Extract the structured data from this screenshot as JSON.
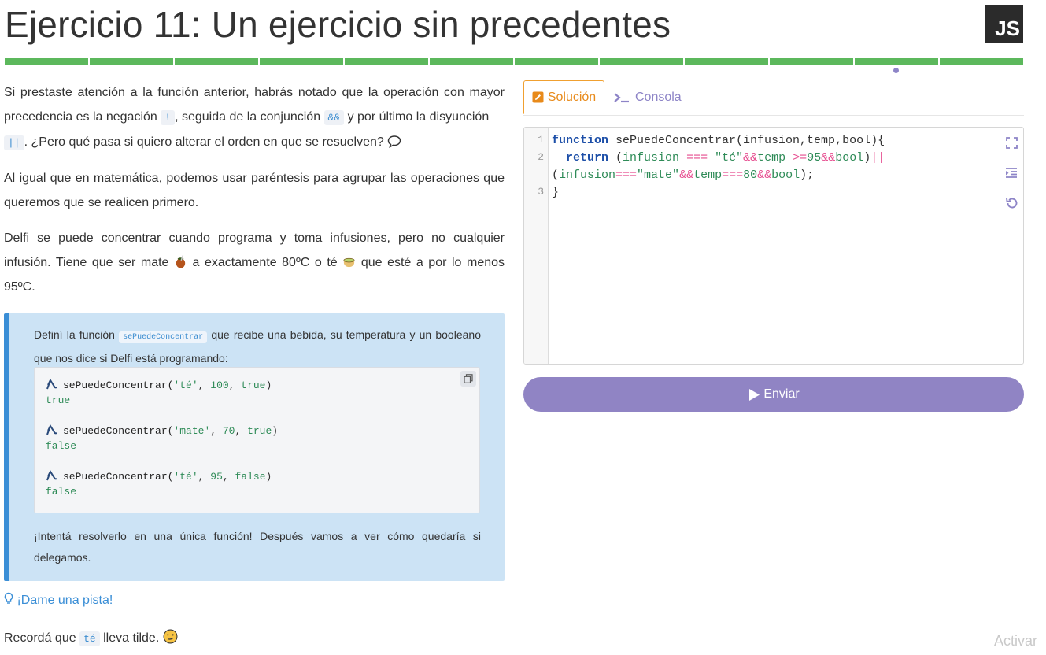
{
  "header": {
    "title": "Ejercicio 11: Un ejercicio sin precedentes",
    "language_badge": "JS",
    "progress_segments": 12,
    "progress_color": "#5cb85c"
  },
  "intro": {
    "p1_a": "Si prestaste atención a la función anterior, habrás notado que la operación con mayor precedencia es la negación ",
    "code_not": "!",
    "p1_b": ", seguida de la conjunción ",
    "code_and": "&&",
    "p1_c": " y por último la disyunción ",
    "code_or": "||",
    "p1_d": ". ¿Pero qué pasa si quiero alterar el orden en que se resuelven?",
    "p2": "Al igual que en matemática, podemos usar paréntesis para agrupar las operaciones que queremos que se realicen primero.",
    "p3_a": "Delfi se puede concentrar cuando programa y toma infusiones, pero no cualquier infusión. Tiene que ser mate ",
    "p3_b": " a exactamente 80ºC o té ",
    "p3_c": " que esté a por lo menos 95ºC."
  },
  "task": {
    "text_a": "Definí la función ",
    "fn_name": "sePuedeConcentrar",
    "text_b": " que recibe una bebida, su temperatura y un booleano que nos dice si Delfi está programando:",
    "examples": [
      {
        "fn": "sePuedeConcentrar(",
        "arg1": "'té'",
        "sep1": ", ",
        "arg2": "100",
        "sep2": ", ",
        "arg3": "true",
        "close": ")",
        "result": "true"
      },
      {
        "fn": "sePuedeConcentrar(",
        "arg1": "'mate'",
        "sep1": ", ",
        "arg2": "70",
        "sep2": ", ",
        "arg3": "true",
        "close": ")",
        "result": "false"
      },
      {
        "fn": "sePuedeConcentrar(",
        "arg1": "'té'",
        "sep1": ", ",
        "arg2": "95",
        "sep2": ", ",
        "arg3": "false",
        "close": ")",
        "result": "false"
      }
    ],
    "footer": "¡Intentá resolverlo en una única función! Después vamos a ver cómo quedaría si delegamos."
  },
  "hint": {
    "label": "¡Dame una pista!"
  },
  "remember": {
    "a": "Recordá que ",
    "code": "té",
    "b": " lleva tilde."
  },
  "watermark": "Activar",
  "tabs": {
    "solution": "Solución",
    "console": "Consola"
  },
  "editor": {
    "line_numbers": [
      "1",
      "2",
      "3"
    ],
    "line1": {
      "kw": "function",
      "rest": " sePuedeConcentrar(infusion,temp,bool){"
    },
    "line2": {
      "indent": "  ",
      "kw": "return",
      "p1": " (",
      "id1": "infusion",
      "sp1": " ",
      "op1": "===",
      "sp2": " ",
      "s1": "\"té\"",
      "op2": "&&",
      "id2": "temp",
      "sp3": " ",
      "op3": ">=",
      "n1": "95",
      "op4": "&&",
      "id3": "bool",
      "p2": ")",
      "op5": "||"
    },
    "line2b": {
      "p1": "(",
      "id1": "infusion",
      "op1": "===",
      "s1": "\"mate\"",
      "op2": "&&",
      "id2": "temp",
      "op3": "===",
      "n1": "80",
      "op4": "&&",
      "id3": "bool",
      "p2": ");"
    },
    "line3": "}"
  },
  "submit": {
    "label": "Enviar"
  },
  "colors": {
    "accent": "#9084c4",
    "tab_active": "#e88a1a",
    "task_bg": "#cce3f5",
    "task_border": "#3a8ed6",
    "link": "#3a8ed6"
  }
}
